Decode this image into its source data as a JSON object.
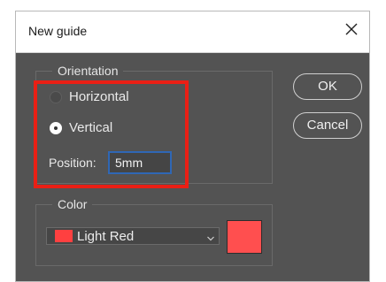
{
  "dialog": {
    "title": "New guide",
    "close_icon": "close-icon"
  },
  "orientation": {
    "legend": "Orientation",
    "options": [
      {
        "label": "Horizontal",
        "selected": false
      },
      {
        "label": "Vertical",
        "selected": true
      }
    ]
  },
  "position": {
    "label": "Position:",
    "value": "5mm"
  },
  "buttons": {
    "ok_label": "OK",
    "cancel_label": "Cancel"
  },
  "color": {
    "legend": "Color",
    "selected": "Light Red",
    "swatch_hex": "#ff4040",
    "preview_hex": "#ff4f4f"
  },
  "colors": {
    "dialog_bg": "#535353",
    "highlight": "#ea1f15",
    "input_focus": "#2f67b5"
  }
}
